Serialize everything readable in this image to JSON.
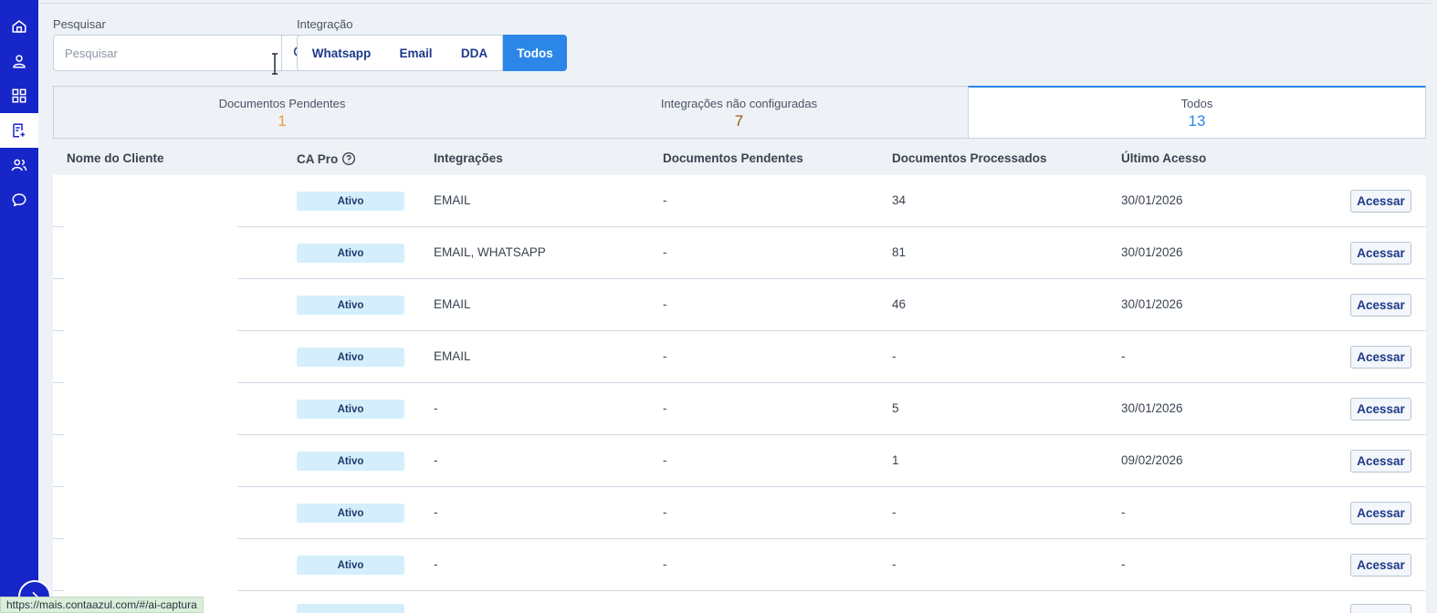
{
  "sidebar": {
    "items": [
      {
        "icon": "home-icon"
      },
      {
        "icon": "user-icon"
      },
      {
        "icon": "grid-icon"
      },
      {
        "icon": "document-add-icon",
        "active": true
      },
      {
        "icon": "users-icon"
      },
      {
        "icon": "chat-icon"
      }
    ]
  },
  "search": {
    "label": "Pesquisar",
    "placeholder": "Pesquisar",
    "value": ""
  },
  "integration": {
    "label": "Integração",
    "options": [
      "Whatsapp",
      "Email",
      "DDA",
      "Todos"
    ],
    "selected": "Todos"
  },
  "tabs": [
    {
      "label": "Documentos Pendentes",
      "count": "1",
      "color": "#e8a03c"
    },
    {
      "label": "Integrações não configuradas",
      "count": "7",
      "color": "#9a5b16"
    },
    {
      "label": "Todos",
      "count": "13",
      "color": "#2b86e8",
      "active": true
    }
  ],
  "table": {
    "columns": {
      "client": "Nome do Cliente",
      "ca_pro": "CA Pro",
      "integrations": "Integrações",
      "pending": "Documentos Pendentes",
      "processed": "Documentos Processados",
      "last_access": "Último Acesso"
    },
    "rows": [
      {
        "status": "Ativo",
        "integrations": "EMAIL",
        "pending": "-",
        "processed": "34",
        "last_access": "30/01/2026",
        "action": "Acessar"
      },
      {
        "status": "Ativo",
        "integrations": "EMAIL, WHATSAPP",
        "pending": "-",
        "processed": "81",
        "last_access": "30/01/2026",
        "action": "Acessar"
      },
      {
        "status": "Ativo",
        "integrations": "EMAIL",
        "pending": "-",
        "processed": "46",
        "last_access": "30/01/2026",
        "action": "Acessar"
      },
      {
        "status": "Ativo",
        "integrations": "EMAIL",
        "pending": "-",
        "processed": "-",
        "last_access": "-",
        "action": "Acessar"
      },
      {
        "status": "Ativo",
        "integrations": "-",
        "pending": "-",
        "processed": "5",
        "last_access": "30/01/2026",
        "action": "Acessar"
      },
      {
        "status": "Ativo",
        "integrations": "-",
        "pending": "-",
        "processed": "1",
        "last_access": "09/02/2026",
        "action": "Acessar"
      },
      {
        "status": "Ativo",
        "integrations": "-",
        "pending": "-",
        "processed": "-",
        "last_access": "-",
        "action": "Acessar"
      },
      {
        "status": "Ativo",
        "integrations": "-",
        "pending": "-",
        "processed": "-",
        "last_access": "-",
        "action": "Acessar"
      }
    ]
  },
  "status_bar": {
    "url": "https://mais.contaazul.com/#/ai-captura"
  },
  "colors": {
    "sidebar": "#1726c8",
    "accent": "#2b86e8",
    "badge_bg": "#d4effb"
  }
}
